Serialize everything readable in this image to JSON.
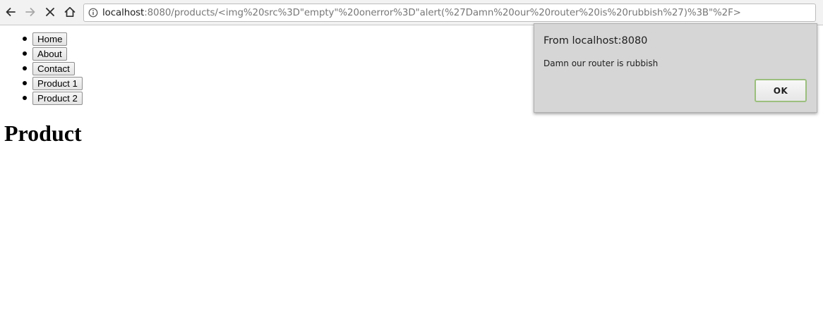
{
  "browser": {
    "nav_icons": [
      "back-arrow-icon",
      "forward-arrow-icon",
      "stop-icon",
      "home-icon"
    ],
    "address": {
      "info_icon": "info-icon",
      "host": "localhost",
      "rest": ":8080/products/<img%20src%3D\"empty\"%20onerror%3D\"alert(%27Damn%20our%20router%20is%20rubbish%27)%3B\"%2F>"
    }
  },
  "page": {
    "nav_items": [
      {
        "label": "Home"
      },
      {
        "label": "About"
      },
      {
        "label": "Contact"
      },
      {
        "label": "Product 1"
      },
      {
        "label": "Product 2"
      }
    ],
    "heading": "Product"
  },
  "dialog": {
    "title": "From localhost:8080",
    "message": "Damn our router is rubbish",
    "ok_label": "OK",
    "ok_border_color": "#9bbf7e"
  }
}
